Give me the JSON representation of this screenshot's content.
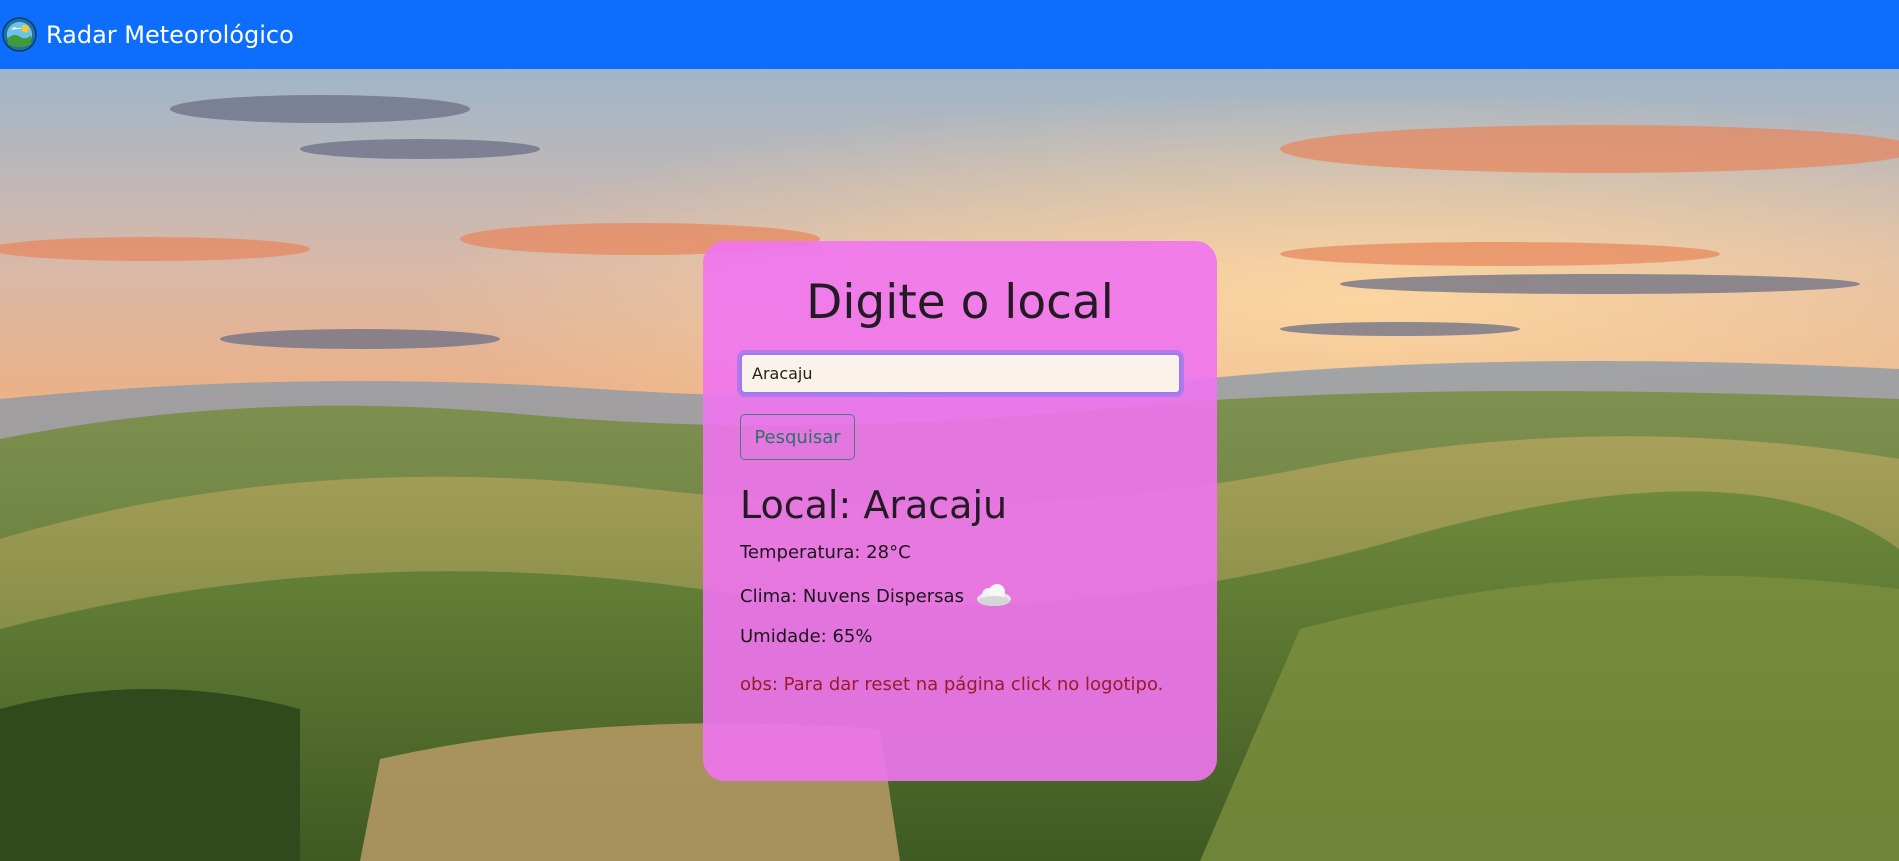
{
  "navbar": {
    "brand": "Radar Meteorológico",
    "color": "#0d6efd"
  },
  "card": {
    "title": "Digite o local",
    "search": {
      "value": "Aracaju",
      "placeholder": ""
    },
    "search_button_label": "Pesquisar",
    "result": {
      "location": "Local: Aracaju",
      "temperature": "Temperatura: 28°C",
      "weather": "Clima: Nuvens Dispersas",
      "weather_icon": "cloud-icon",
      "humidity": "Umidade: 65%"
    },
    "note": "obs: Para dar reset na página click no logotipo."
  }
}
